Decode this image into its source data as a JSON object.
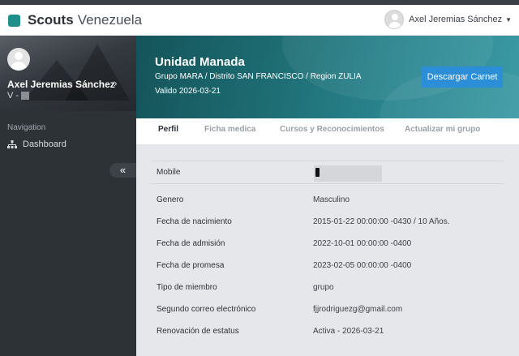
{
  "header": {
    "brand_strong": "Scouts",
    "brand_light": "Venezuela",
    "user_name": "Axel Jeremias Sánchez"
  },
  "sidebar": {
    "profile_name": "Axel Jeremias Sánchez",
    "profile_id_prefix": "V -",
    "nav_heading": "Navigation",
    "items": [
      {
        "label": "Dashboard",
        "icon": "sitemap-icon"
      }
    ],
    "collapse_label": "«"
  },
  "banner": {
    "title": "Unidad Manada",
    "path": "Grupo MARA / Distrito SAN FRANCISCO / Region ZULIA",
    "valid": "Valido 2026-03-21",
    "download_label": "Descargar Carnet"
  },
  "tabs": [
    {
      "label": "Perfil",
      "active": true
    },
    {
      "label": "Ficha medica",
      "active": false
    },
    {
      "label": "Cursos y Reconocimientos",
      "active": false
    },
    {
      "label": "Actualizar mi grupo",
      "active": false
    }
  ],
  "profile": {
    "mobile_label": "Mobile",
    "rows": [
      {
        "label": "Genero",
        "value": "Masculino"
      },
      {
        "label": "Fecha de nacimiento",
        "value": "2015-01-22 00:00:00 -0430 / 10 Años."
      },
      {
        "label": "Fecha de admisión",
        "value": "2022-10-01 00:00:00 -0400"
      },
      {
        "label": "Fecha de promesa",
        "value": "2023-02-05 00:00:00 -0400"
      },
      {
        "label": "Tipo de miembro",
        "value": "grupo"
      },
      {
        "label": "Segundo correo electrónico",
        "value": "fjjrodriguezg@gmail.com"
      },
      {
        "label": "Renovación de estatus",
        "value": "Activa - 2026-03-21"
      }
    ]
  },
  "colors": {
    "accent": "#2d8ed8",
    "brand": "#1f8f8c",
    "sidebar_bg": "#2d3237",
    "banner_teal": "#1d6c72"
  }
}
